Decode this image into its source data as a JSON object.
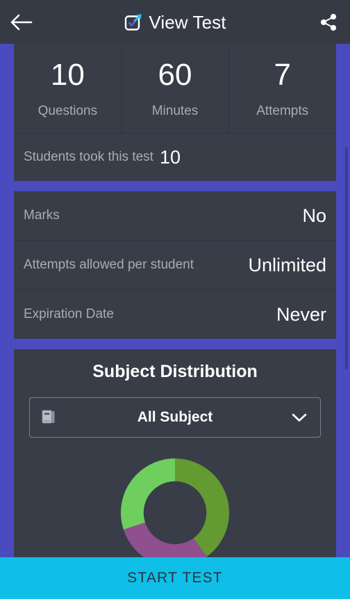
{
  "appbar": {
    "back_icon": "arrow-left-icon",
    "logo_icon": "checkbox-external-link-icon",
    "title": "View Test",
    "share_icon": "share-icon"
  },
  "stats": {
    "items": [
      {
        "value": "10",
        "label": "Questions"
      },
      {
        "value": "60",
        "label": "Minutes"
      },
      {
        "value": "7",
        "label": "Attempts"
      }
    ],
    "took": {
      "label": "Students took this test",
      "value": "10"
    }
  },
  "info": {
    "rows": [
      {
        "label": "Marks",
        "value": "No"
      },
      {
        "label": "Attempts allowed per student",
        "value": "Unlimited"
      },
      {
        "label": "Expiration Date",
        "value": "Never"
      }
    ]
  },
  "subject": {
    "title": "Subject Distribution",
    "dropdown": {
      "icon": "book-icon",
      "value": "All Subject",
      "chevron": "chevron-down-icon"
    }
  },
  "chart_data": {
    "type": "pie",
    "variant": "donut",
    "title": "Subject Distribution",
    "legend": "none",
    "labels": [
      "Segment 1",
      "Segment 2",
      "Segment 3"
    ],
    "values": [
      40,
      30,
      30
    ],
    "colors": [
      "#639a32",
      "#90508f",
      "#6ecf5e"
    ],
    "start_angle_deg": 0,
    "inner_radius_ratio": 0.58,
    "outer_radius_px": 78
  },
  "footer": {
    "start_label": "START TEST"
  },
  "colors": {
    "page_background": "#4a4bbf",
    "card_background": "#383d48",
    "appbar_background": "#353a45",
    "accent": "#0fbfe8",
    "muted_text": "#a9acb5"
  },
  "scrollbar": {
    "thumb_color": "#3b3c9e"
  }
}
